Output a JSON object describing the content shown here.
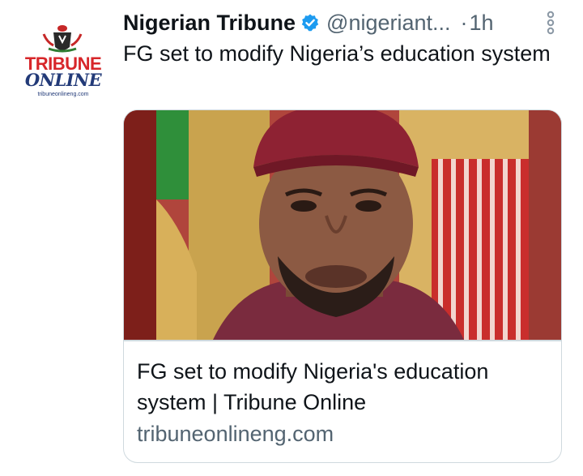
{
  "author": {
    "name": "Nigerian Tribune",
    "handle": "@nigeriant...",
    "separator": "·",
    "time": "1h",
    "verified": true,
    "avatar": {
      "logo_line1": "TRIBUNE",
      "logo_line2": "ONLINE",
      "logo_url": "tribuneonlineng.com"
    }
  },
  "tweet": {
    "text": "FG set to modify Nigeria’s education system"
  },
  "card": {
    "title": "FG set to modify Nigeria's education system | Tribune Online",
    "domain": "tribuneonlineng.com"
  },
  "icons": {
    "verified": "verified-badge-icon",
    "more": "more-vertical-icon"
  },
  "colors": {
    "verified_blue": "#1d9bf0",
    "secondary_text": "#536471",
    "primary_text": "#0f1419",
    "tribune_red": "#d7262a",
    "tribune_blue": "#223a78"
  }
}
